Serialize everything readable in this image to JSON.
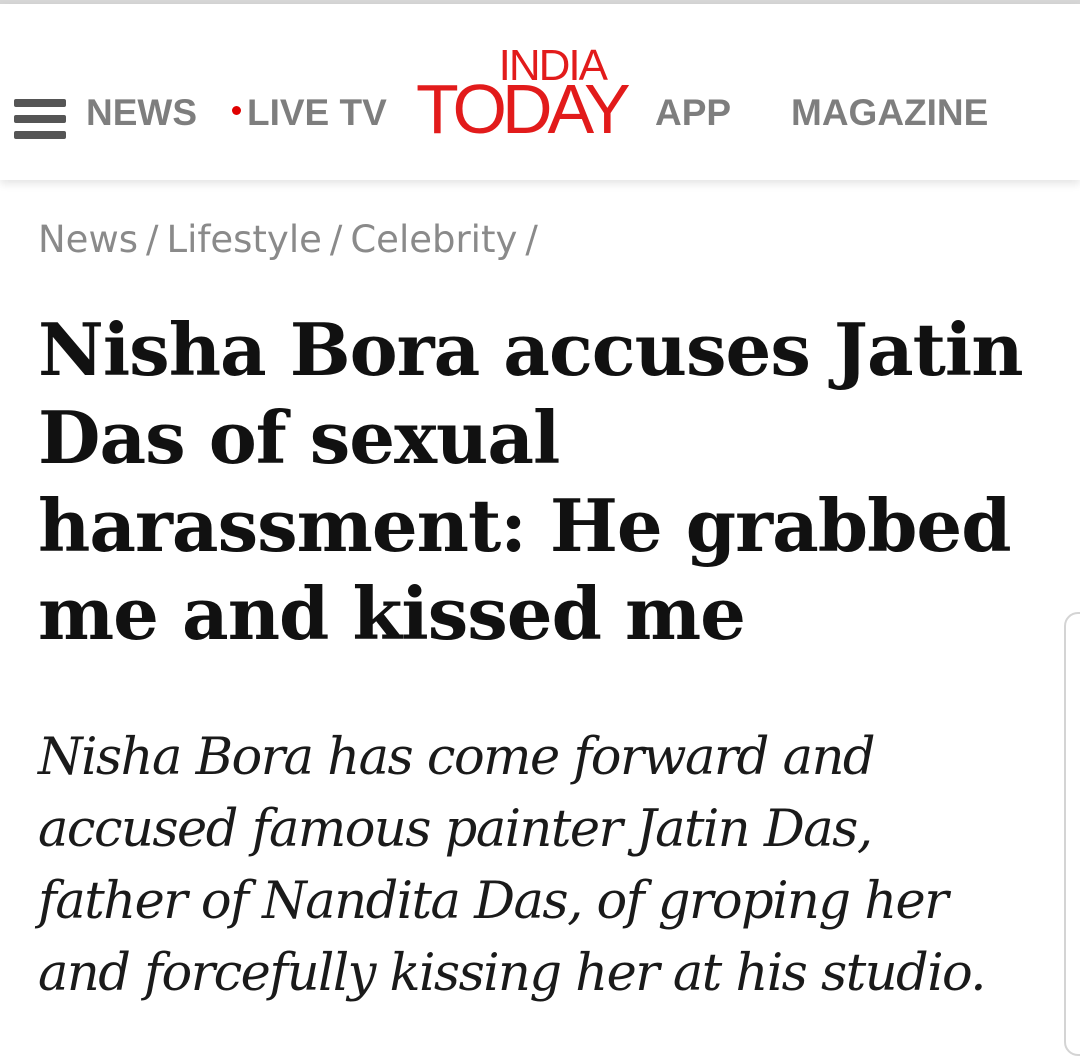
{
  "header": {
    "menu_icon": "hamburger-menu-icon",
    "nav": {
      "news": "NEWS",
      "live_tv": "LIVE TV",
      "app": "APP",
      "magazine": "MAGAZINE"
    },
    "logo": {
      "line1": "INDIA",
      "line2": "TODAY"
    },
    "colors": {
      "brand_red": "#e21b1b",
      "live_dot": "#e00000",
      "nav_gray": "#7e7e7e"
    }
  },
  "breadcrumb": {
    "items": [
      "News",
      "Lifestyle",
      "Celebrity"
    ],
    "separator": "/"
  },
  "article": {
    "headline": "Nisha Bora accuses Jatin Das of sexual harassment: He grabbed me and kissed me",
    "summary": "Nisha Bora has come forward and accused famous painter Jatin Das, father of Nandita Das, of groping her and forcefully kissing her at his studio."
  }
}
